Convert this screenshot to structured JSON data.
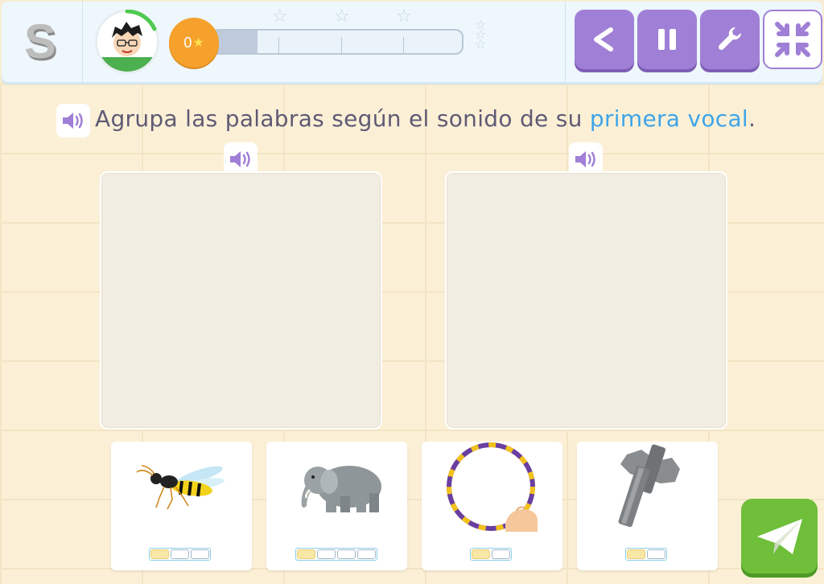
{
  "header": {
    "logo": "S",
    "score": "0",
    "progress_percent": 18,
    "progress_stars": 3
  },
  "toolbar": {
    "back_icon": "back-arrow-icon",
    "pause_icon": "pause-icon",
    "settings_icon": "wrench-icon",
    "fullscreen_icon": "exit-fullscreen-icon"
  },
  "instruction": {
    "text_before": "Agrupa las palabras según el sonido de su ",
    "highlight": "primera vocal",
    "text_after": "."
  },
  "cards": [
    {
      "picture": "wasp",
      "syllables": 3,
      "filled": 1
    },
    {
      "picture": "elephant",
      "syllables": 4,
      "filled": 1
    },
    {
      "picture": "hoop",
      "syllables": 2,
      "filled": 1
    },
    {
      "picture": "axle",
      "syllables": 2,
      "filled": 1
    }
  ],
  "colors": {
    "accent_purple": "#a07fd6",
    "highlight_blue": "#3ea4e8",
    "send_green": "#6fbf3a",
    "coin_orange": "#f5a12c"
  }
}
